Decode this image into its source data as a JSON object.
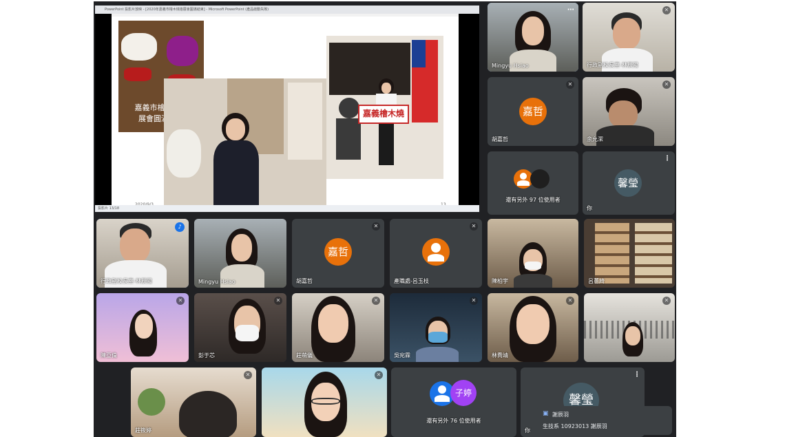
{
  "presentation": {
    "window_title": "PowerPoint 投影片放映 - [2020年嘉義市檜木燒烙展會圓滿結束] - Microsoft PowerPoint (產品啟動失敗)",
    "slide_caption_line1": "嘉義市檜木燒烙",
    "slide_caption_line2": "展會圓滿結束",
    "banner_text": "嘉義檜木燒",
    "date": "2020/9/3",
    "page_number": "13",
    "status_bar": "投影片 13/18"
  },
  "tiles": [
    {
      "name": "Mingyu Hsiao",
      "avatar": ""
    },
    {
      "name": "行政副校長室-林辰陽",
      "avatar": ""
    },
    {
      "name": "胡嘉哲",
      "avatar": "嘉哲"
    },
    {
      "name": "余允潔",
      "avatar": ""
    },
    {
      "name": "還有另外 97 位使用者",
      "avatar": ""
    },
    {
      "name": "你",
      "avatar": "馨瑩"
    },
    {
      "name": "行政副校長室-林辰陽",
      "avatar": ""
    },
    {
      "name": "Mingyu Hsiao",
      "avatar": ""
    },
    {
      "name": "胡嘉哲",
      "avatar": "嘉哲"
    },
    {
      "name": "產職處-呂玉枝",
      "avatar": ""
    },
    {
      "name": "陳柏宇",
      "avatar": ""
    },
    {
      "name": "呂蕙綺",
      "avatar": ""
    },
    {
      "name": "陳亞倫",
      "avatar": ""
    },
    {
      "name": "彭于芯",
      "avatar": ""
    },
    {
      "name": "莊萌儀",
      "avatar": ""
    },
    {
      "name": "吳宛霖",
      "avatar": ""
    },
    {
      "name": "林喬靖",
      "avatar": ""
    },
    {
      "name": "",
      "avatar": ""
    },
    {
      "name": "莊筱婷",
      "avatar": ""
    },
    {
      "name": "",
      "avatar": ""
    },
    {
      "name": "還有另外 76 位使用者",
      "avatar": "子婷"
    },
    {
      "name": "你",
      "avatar": "馨瑩"
    }
  ],
  "toast": {
    "sender": "謝辰羽",
    "message": "生技系 10923013 謝辰羽"
  },
  "colors": {
    "app_bg": "#202124",
    "tile_bg": "#3c4043",
    "orange_avatar": "#e8710a",
    "purple_avatar": "#a142f4",
    "teal_avatar": "#5f6368"
  }
}
